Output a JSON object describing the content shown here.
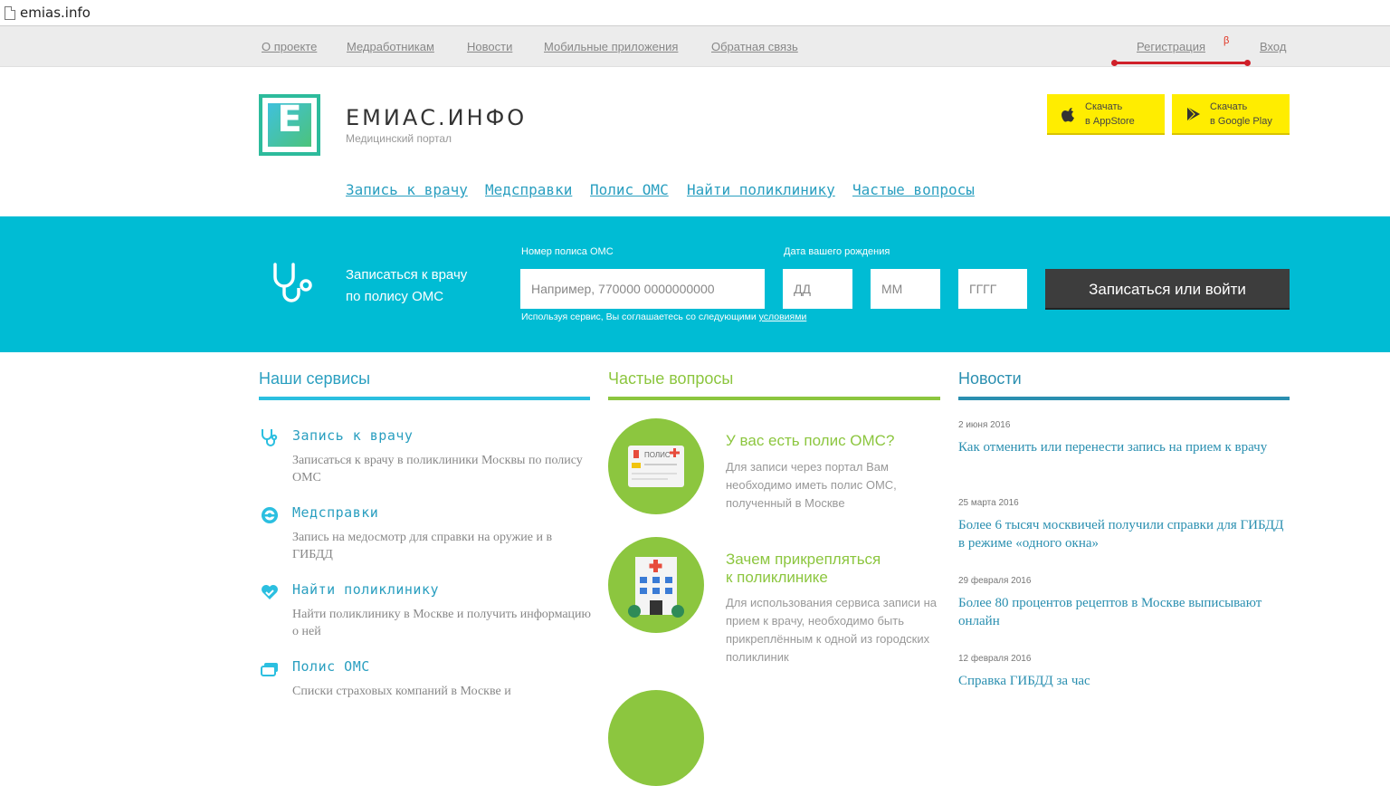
{
  "browser": {
    "url": "emias.info"
  },
  "topnav": {
    "items": [
      "О проекте",
      "Медработникам",
      "Новости",
      "Мобильные приложения",
      "Обратная связь"
    ],
    "register": "Регистрация",
    "beta": "β",
    "login": "Вход"
  },
  "header": {
    "logo_letter": "Е",
    "brand": "ЕМИАС.ИНФО",
    "tagline": "Медицинский портал",
    "appstore": {
      "line1": "Скачать",
      "line2": "в AppStore"
    },
    "googleplay": {
      "line1": "Скачать",
      "line2": "в Google Play"
    }
  },
  "mainnav": [
    "Запись к врачу",
    "Медсправки",
    "Полис ОМС",
    "Найти поликлинику",
    "Частые вопросы"
  ],
  "booking": {
    "title_line1": "Записаться к врачу",
    "title_line2": "по полису ОМС",
    "policy_label": "Номер полиса ОМС",
    "policy_placeholder": "Например, 770000 0000000000",
    "dob_label": "Дата вашего рождения",
    "day_placeholder": "ДД",
    "month_placeholder": "ММ",
    "year_placeholder": "ГГГГ",
    "terms_text": "Используя сервис, Вы соглашаетесь со следующими",
    "terms_link": "условиями",
    "submit": "Записаться или войти"
  },
  "services": {
    "title": "Наши сервисы",
    "items": [
      {
        "icon": "stethoscope-icon",
        "label": "Запись к врачу",
        "desc": "Записаться к врачу в поликлиники Москвы по полису ОМС"
      },
      {
        "icon": "steering-wheel-icon",
        "label": "Медсправки",
        "desc": "Запись на медосмотр для справки на оружие и в ГИБДД"
      },
      {
        "icon": "heart-check-icon",
        "label": "Найти поликлинику",
        "desc": "Найти поликлинику в Москве и получить информацию о ней"
      },
      {
        "icon": "card-icon",
        "label": "Полис ОМС",
        "desc": "Списки страховых компаний в Москве и"
      }
    ]
  },
  "faq": {
    "title": "Частые вопросы",
    "items": [
      {
        "icon": "policy-card-icon",
        "question": "У вас есть полис ОМС?",
        "answer": "Для записи через портал Вам необходимо иметь полис ОМС, полученный в Москве",
        "card_text": "ПОЛИС"
      },
      {
        "icon": "hospital-icon",
        "question_line1": "Зачем прикрепляться",
        "question_line2": "к поликлинике",
        "answer": "Для использования сервиса записи на прием к врачу, необходимо быть прикреплённым к одной из городских поликлиник"
      }
    ]
  },
  "news": {
    "title": "Новости",
    "items": [
      {
        "date": "2 июня 2016",
        "title": "Как отменить или перенести запись на прием к врачу"
      },
      {
        "date": "25 марта 2016",
        "title": "Более 6 тысяч москвичей получили справки для ГИБДД в режиме «одного окна»"
      },
      {
        "date": "29 февраля 2016",
        "title": "Более 80 процентов рецептов в Москве выписывают онлайн"
      },
      {
        "date": "12 февраля 2016",
        "title": "Справка ГИБДД за час"
      }
    ]
  },
  "colors": {
    "accent_blue": "#00bcd4",
    "faq_green": "#8cc63f",
    "news_blue": "#2a8fb0",
    "store_yellow": "#ffed00"
  }
}
